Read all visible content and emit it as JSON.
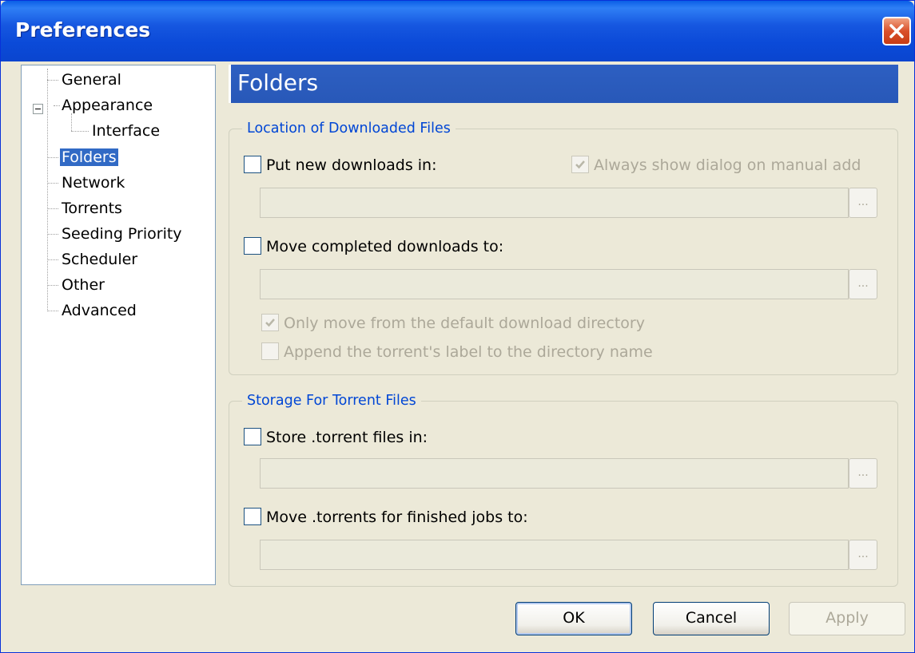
{
  "window": {
    "title": "Preferences"
  },
  "tree": {
    "items": [
      {
        "label": "General"
      },
      {
        "label": "Appearance"
      },
      {
        "label": "Interface"
      },
      {
        "label": "Folders"
      },
      {
        "label": "Network"
      },
      {
        "label": "Torrents"
      },
      {
        "label": "Seeding Priority"
      },
      {
        "label": "Scheduler"
      },
      {
        "label": "Other"
      },
      {
        "label": "Advanced"
      }
    ],
    "selected": "Folders"
  },
  "header": {
    "title": "Folders"
  },
  "location_group": {
    "legend": "Location of Downloaded Files",
    "put_new_label": "Put new downloads in:",
    "always_show_label": "Always show dialog on manual add",
    "move_completed_label": "Move completed downloads to:",
    "only_move_label": "Only move from the default download directory",
    "append_label_label": "Append the torrent's label to the directory name",
    "put_new_path": "",
    "move_completed_path": ""
  },
  "storage_group": {
    "legend": "Storage For Torrent Files",
    "store_label": "Store .torrent files in:",
    "move_torrents_label": "Move .torrents for finished jobs to:",
    "store_path": "",
    "move_torrents_path": ""
  },
  "browse_label": "...",
  "buttons": {
    "ok": "OK",
    "cancel": "Cancel",
    "apply": "Apply"
  },
  "colors": {
    "selection": "#316ac5",
    "header_bar": "#2d5fc2",
    "legend_text": "#0046d5",
    "dialog_bg": "#ece9d8"
  }
}
